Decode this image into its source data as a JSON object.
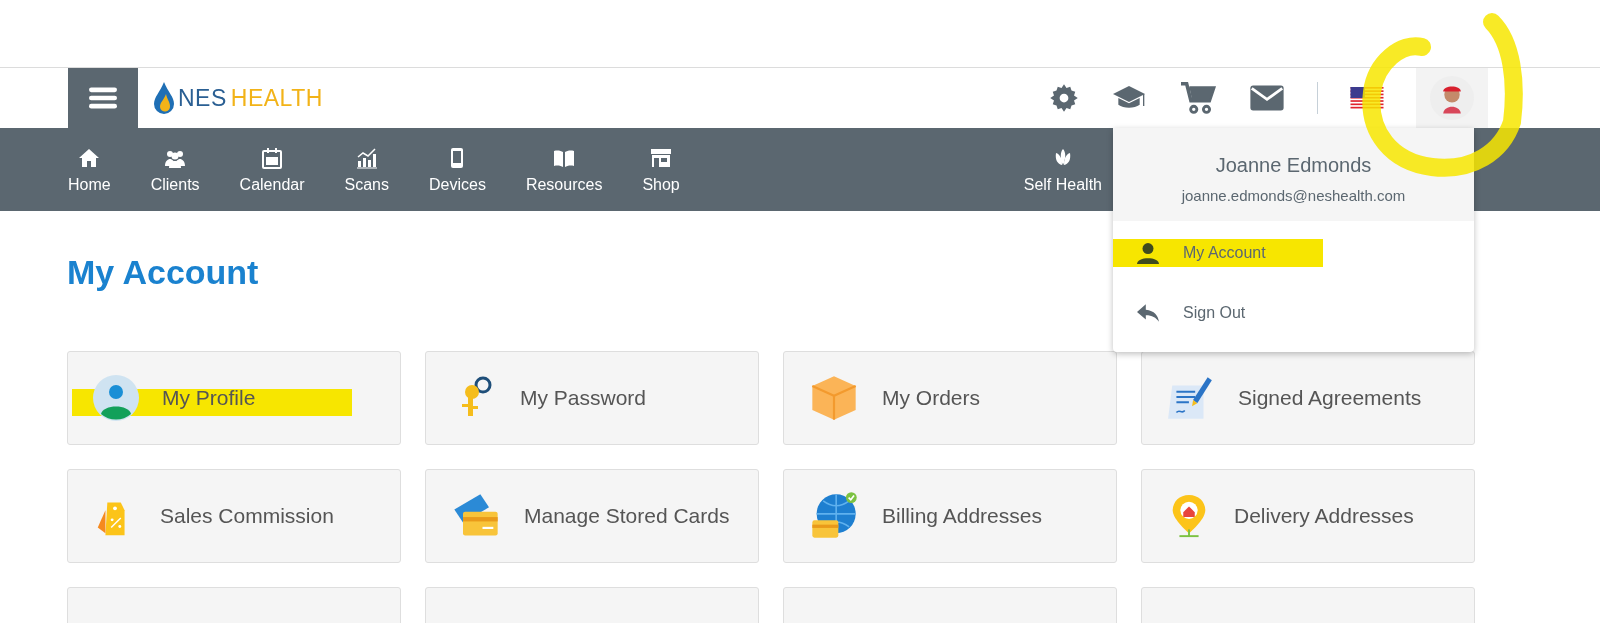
{
  "header": {
    "logo": {
      "first": "NES",
      "second": "HEALTH"
    },
    "tools": [
      {
        "kind": "gear"
      },
      {
        "kind": "cap"
      },
      {
        "kind": "cart"
      },
      {
        "kind": "mail"
      },
      {
        "kind": "flag"
      },
      {
        "kind": "avatar"
      }
    ]
  },
  "nav": {
    "left": [
      {
        "label": "Home",
        "kind": "home"
      },
      {
        "label": "Clients",
        "kind": "clients"
      },
      {
        "label": "Calendar",
        "kind": "calendar"
      },
      {
        "label": "Scans",
        "kind": "scans"
      },
      {
        "label": "Devices",
        "kind": "devices"
      },
      {
        "label": "Resources",
        "kind": "resources"
      },
      {
        "label": "Shop",
        "kind": "shop"
      }
    ],
    "right": [
      {
        "label": "Self Health",
        "kind": "lotus"
      }
    ]
  },
  "user_menu": {
    "name": "Joanne Edmonds",
    "email": "joanne.edmonds@neshealth.com",
    "items": [
      {
        "label": "My Account",
        "kind": "person",
        "highlighted": true
      },
      {
        "label": "Sign Out",
        "kind": "reply",
        "highlighted": false
      }
    ]
  },
  "page_title": "My Account",
  "cards": [
    {
      "label": "My Profile",
      "kind": "profile",
      "highlighted": true
    },
    {
      "label": "My Password",
      "kind": "key",
      "highlighted": false
    },
    {
      "label": "My Orders",
      "kind": "box",
      "highlighted": false
    },
    {
      "label": "Signed Agreements",
      "kind": "document",
      "highlighted": false
    },
    {
      "label": "Sales Commission",
      "kind": "tag",
      "highlighted": false
    },
    {
      "label": "Manage Stored Cards",
      "kind": "card",
      "highlighted": false
    },
    {
      "label": "Billing Addresses",
      "kind": "globe",
      "highlighted": false
    },
    {
      "label": "Delivery Addresses",
      "kind": "pin",
      "highlighted": false
    },
    {
      "kind": "blank"
    },
    {
      "kind": "blank"
    },
    {
      "kind": "blank"
    },
    {
      "kind": "blank"
    }
  ],
  "annotation": {
    "circle_around_avatar": true
  }
}
